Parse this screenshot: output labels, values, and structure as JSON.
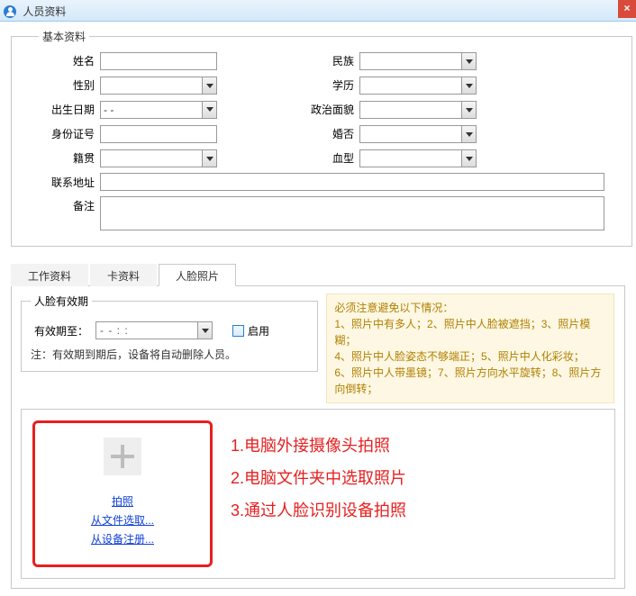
{
  "window": {
    "title": "人员资料"
  },
  "basic": {
    "legend": "基本资料",
    "name_label": "姓名",
    "name_value": "",
    "nation_label": "民族",
    "nation_value": "",
    "gender_label": "性别",
    "gender_value": "",
    "education_label": "学历",
    "education_value": "",
    "birthdate_label": "出生日期",
    "birthdate_value": "-    -",
    "politics_label": "政治面貌",
    "politics_value": "",
    "idno_label": "身份证号",
    "idno_value": "",
    "marriage_label": "婚否",
    "marriage_value": "",
    "origin_label": "籍贯",
    "origin_value": "",
    "blood_label": "血型",
    "blood_value": "",
    "address_label": "联系地址",
    "address_value": "",
    "remark_label": "备注",
    "remark_value": ""
  },
  "tabs": {
    "work": "工作资料",
    "card": "卡资料",
    "face": "人脸照片"
  },
  "validity": {
    "legend": "人脸有效期",
    "until_label": "有效期至：",
    "until_value": "-    -         :    :",
    "enable_label": "启用",
    "note": "注：有效期到期后，设备将自动删除人员。"
  },
  "warning": {
    "title": "必须注意避免以下情况：",
    "line1": "1、照片中有多人；2、照片中人脸被遮挡；3、照片模糊；",
    "line2": "4、照片中人脸姿态不够端正；5、照片中人化彩妆；",
    "line3": "6、照片中人带墨镜；7、照片方向水平旋转；8、照片方向倒转；"
  },
  "photo_actions": {
    "take": "拍照",
    "from_file": "从文件选取...",
    "from_device": "从设备注册..."
  },
  "annotations": {
    "a1": "1.电脑外接摄像头拍照",
    "a2": "2.电脑文件夹中选取照片",
    "a3": "3.通过人脸识别设备拍照"
  }
}
